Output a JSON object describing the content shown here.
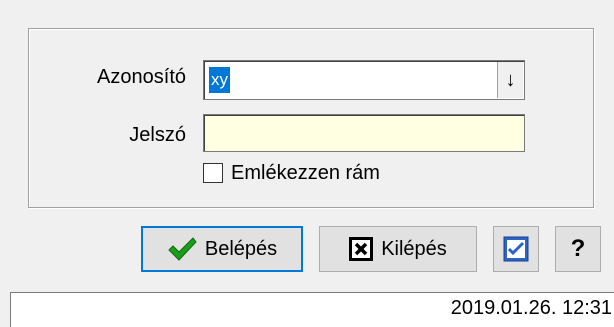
{
  "form": {
    "id_label": "Azonosító",
    "id_value": "xy",
    "id_dropdown_icon": "arrow-down-icon",
    "password_label": "Jelszó",
    "password_value": "",
    "remember_label": "Emlékezzen rám",
    "remember_checked": false
  },
  "buttons": {
    "login_label": "Belépés",
    "login_icon": "checkmark-icon",
    "exit_label": "Kilépés",
    "exit_icon": "close-box-icon",
    "check_icon": "check-box-icon",
    "help_label": "?"
  },
  "colors": {
    "selection": "#0078d7",
    "password_bg": "#ffffe1",
    "checkmark_green": "#1a9d1a"
  },
  "status": {
    "datetime": "2019.01.26. 12:31"
  }
}
